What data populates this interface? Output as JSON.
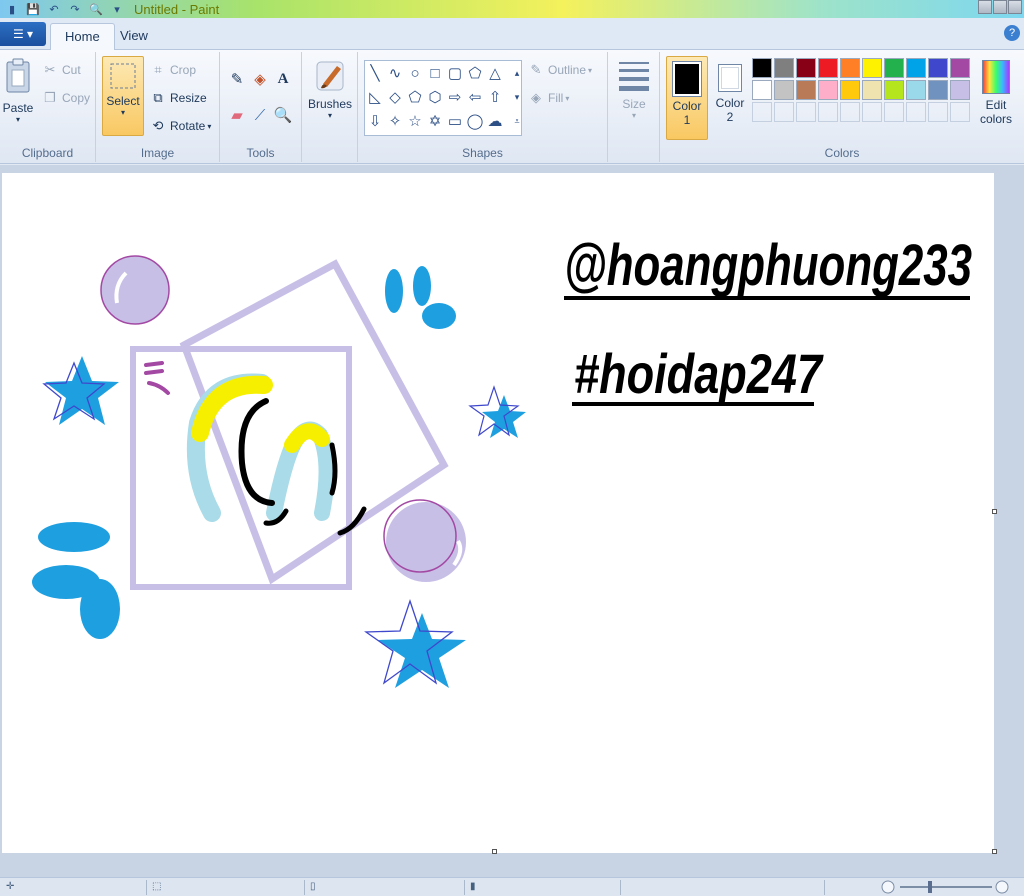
{
  "window": {
    "title": "Untitled - Paint"
  },
  "tabs": {
    "home": "Home",
    "view": "View"
  },
  "clipboard": {
    "paste": "Paste",
    "cut": "Cut",
    "copy": "Copy",
    "label": "Clipboard"
  },
  "image": {
    "select": "Select",
    "crop": "Crop",
    "resize": "Resize",
    "rotate": "Rotate",
    "label": "Image"
  },
  "tools": {
    "label": "Tools"
  },
  "brushes": {
    "label": "Brushes"
  },
  "shapes": {
    "outline": "Outline",
    "fill": "Fill",
    "label": "Shapes"
  },
  "size": {
    "label": "Size"
  },
  "colors": {
    "color1_label": "Color",
    "color1_num": "1",
    "color2_label": "Color",
    "color2_num": "2",
    "edit_label": "Edit",
    "edit_label2": "colors",
    "label": "Colors",
    "color1_value": "#000000",
    "color2_value": "#ffffff",
    "palette_row1": [
      "#000000",
      "#7f7f7f",
      "#880015",
      "#ed1c24",
      "#ff7f27",
      "#fff200",
      "#22b14c",
      "#00a2e8",
      "#3f48cc",
      "#a349a4"
    ],
    "palette_row2": [
      "#ffffff",
      "#c3c3c3",
      "#b97a57",
      "#ffaec9",
      "#ffc90e",
      "#efe4b0",
      "#b5e61d",
      "#99d9ea",
      "#7092be",
      "#c8bfe7"
    ]
  },
  "drawing": {
    "handle_text": "@hoangphuong233",
    "hashtag_text": "#hoidap247",
    "accent_purple": "#c8bfe7",
    "accent_blue": "#1e9fe0",
    "accent_yellow": "#f7ef00",
    "accent_lightblue": "#a9dbe8"
  }
}
